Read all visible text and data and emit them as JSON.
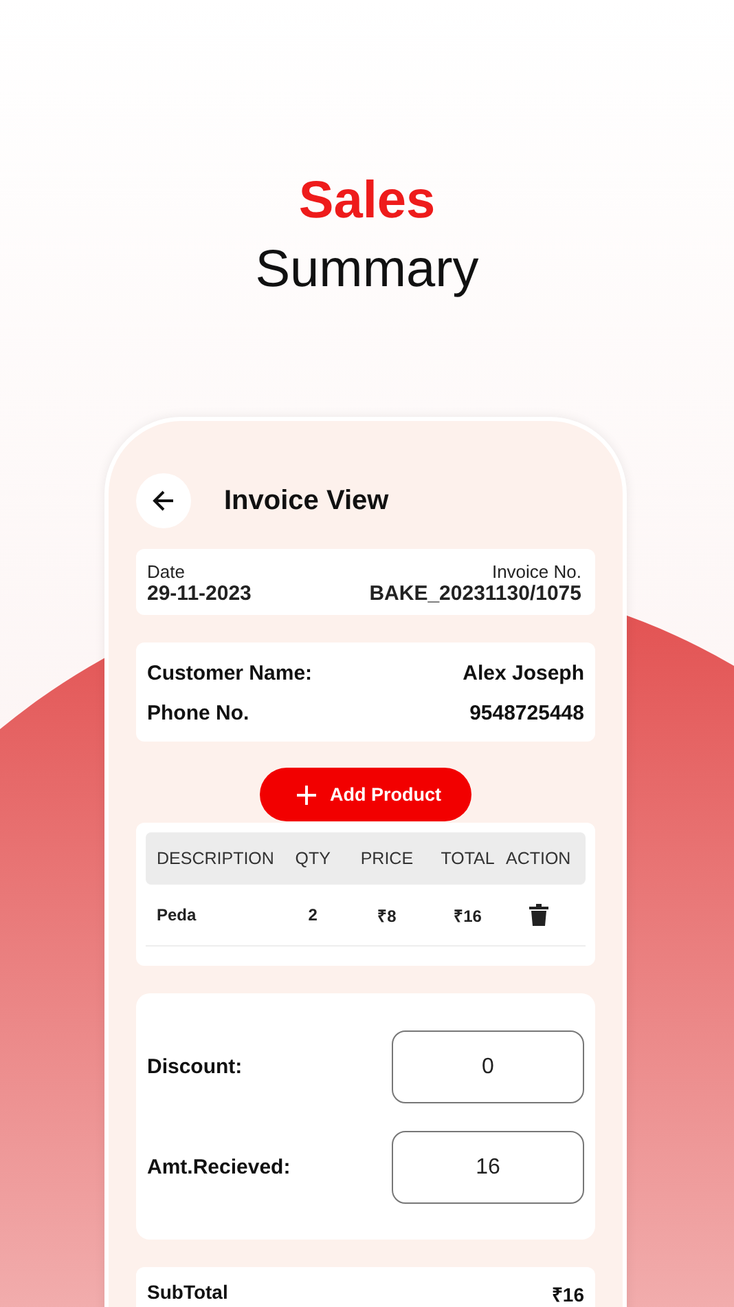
{
  "headline": {
    "accent": "Sales",
    "title": "Summary"
  },
  "screen": {
    "title": "Invoice View",
    "invoice": {
      "date_label": "Date",
      "date": "29-11-2023",
      "number_label": "Invoice No.",
      "number": "BAKE_20231130/1075"
    },
    "customer": [
      {
        "label": "Customer Name:",
        "value": "Alex Joseph"
      },
      {
        "label": "Phone No.",
        "value": "9548725448"
      }
    ],
    "add_button": "Add Product",
    "table": {
      "columns": [
        "DESCRIPTION",
        "QTY",
        "PRICE",
        "TOTAL",
        "ACTION"
      ],
      "rows": [
        {
          "description": "Peda",
          "qty": "2",
          "price": "₹8",
          "total": "₹16"
        }
      ]
    },
    "fields": [
      {
        "label": "Discount:",
        "value": "0"
      },
      {
        "label": "Amt.Recieved:",
        "value": "16"
      }
    ],
    "subtotal": {
      "label": "SubTotal",
      "value": "₹16"
    }
  }
}
